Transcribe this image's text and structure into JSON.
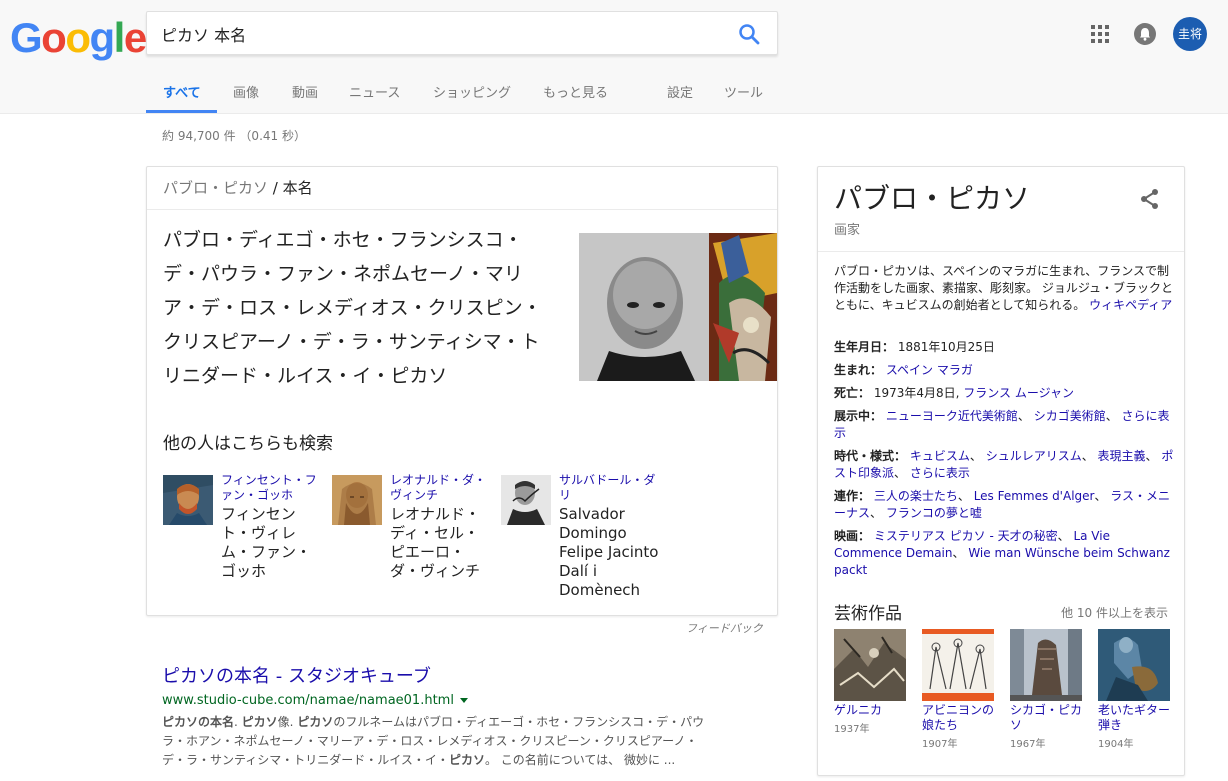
{
  "header": {
    "logo_letters": [
      {
        "char": "G",
        "color": "#4285F4"
      },
      {
        "char": "o",
        "color": "#EA4335"
      },
      {
        "char": "o",
        "color": "#FBBC05"
      },
      {
        "char": "g",
        "color": "#4285F4"
      },
      {
        "char": "l",
        "color": "#34A853"
      },
      {
        "char": "e",
        "color": "#EA4335"
      }
    ],
    "search_query": "ピカソ 本名",
    "avatar_text": "圭将",
    "tabs": [
      "すべて",
      "画像",
      "動画",
      "ニュース",
      "ショッピング",
      "もっと見る",
      "設定",
      "ツール"
    ]
  },
  "stats": "約 94,700 件 （0.41 秒）",
  "answer_card": {
    "breadcrumb_parent": "パブロ・ピカソ",
    "breadcrumb_sep": "/",
    "breadcrumb_current": "本名",
    "answer": "パブロ・ディエゴ・ホセ・フランシスコ・デ・パウラ・ファン・ネポムセーノ・マリア・デ・ロス・レメディオス・クリスピン・クリスピアーノ・デ・ラ・サンティシマ・トリニダード・ルイス・イ・ピカソ",
    "people_title": "他の人はこちらも検索",
    "people": [
      {
        "link": "フィンセント・ファン・ゴッホ",
        "full": "フィンセント・ヴィレム・ファン・ゴッホ"
      },
      {
        "link": "レオナルド・ダ・ヴィンチ",
        "full": "レオナルド・ディ・セル・ピエーロ・ダ・ヴィンチ"
      },
      {
        "link": "サルバドール・ダリ",
        "full": "Salvador Domingo Felipe Jacinto Dalí i Domènech"
      }
    ],
    "feedback": "フィードバック"
  },
  "result": {
    "title": "ピカソの本名 - スタジオキューブ",
    "url": "www.studio-cube.com/namae/namae01.html",
    "snippet_line1_a": "ピカソの本名",
    "snippet_line1_b": ". ",
    "snippet_line1_c": "ピカソ",
    "snippet_line1_d": "像. ",
    "snippet_line1_e": "ピカソ",
    "snippet_line1_f": "のフルネームはパブロ・ディエーゴ・ホセ・フランシスコ・デ・パウ",
    "snippet_line2": "ラ・ホアン・ネポムセーノ・マリーア・デ・ロス・レメディオス・クリスピーン・クリスピアーノ・",
    "snippet_line3_a": "デ・ラ・サンティシマ・トリニダード・ルイス・イ・",
    "snippet_line3_b": "ピカソ",
    "snippet_line3_c": "。 この名前については、 微妙に ..."
  },
  "knowledge_panel": {
    "title": "パブロ・ピカソ",
    "subtitle": "画家",
    "description": "パブロ・ピカソは、スペインのマラガに生まれ、フランスで制作活動をした画家、素描家、彫刻家。 ジョルジュ・ブラックとともに、キュビスムの創始者として知られる。",
    "wiki_link": "ウィキペディア",
    "facts": {
      "born_key": "生年月日：",
      "born_val": "1881年10月25日",
      "birthplace_key": "生まれ：",
      "birthplace_val": "スペイン マラガ",
      "died_key": "死亡：",
      "died_val": "1973年4月8日,",
      "died_place": "フランス ムージャン",
      "exhibit_key": "展示中：",
      "exhibit_1": "ニューヨーク近代美術館",
      "exhibit_2": "シカゴ美術館",
      "exhibit_more": "さらに表示",
      "era_key": "時代・様式：",
      "era_1": "キュビスム",
      "era_2": "シュルレアリスム",
      "era_3": "表現主義",
      "era_4": "ポスト印象派",
      "era_more": "さらに表示",
      "works_key": "連作：",
      "works_1": "三人の楽士たち",
      "works_2": "Les Femmes d'Alger",
      "works_3": "ラス・メニーナス",
      "works_4": "フランコの夢と嘘",
      "films_key": "映画：",
      "film_1": "ミステリアス ピカソ - 天才の秘密",
      "film_2": "La Vie Commence Demain",
      "film_3": "Wie man Wünsche beim Schwanz packt"
    },
    "works_title": "芸術作品",
    "works_more": "他 10 件以上を表示",
    "works": [
      {
        "name": "ゲルニカ",
        "year": "1937年"
      },
      {
        "name": "アビニヨンの娘たち",
        "year": "1907年"
      },
      {
        "name": "シカゴ・ピカソ",
        "year": "1967年"
      },
      {
        "name": "老いたギター弾き",
        "year": "1904年"
      }
    ]
  }
}
